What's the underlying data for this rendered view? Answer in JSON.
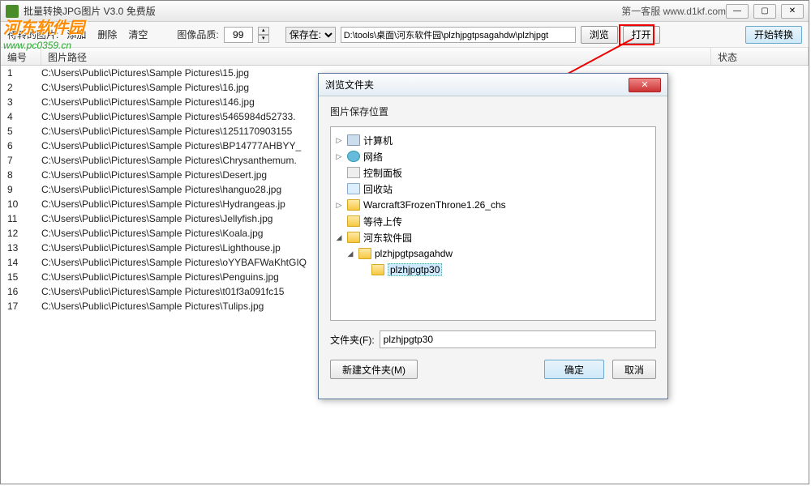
{
  "window": {
    "title": "批量转换JPG图片 V3.0 免费版",
    "subtitle": "第一客服 www.d1kf.com"
  },
  "watermark": {
    "line1": "河东软件园",
    "line2": "www.pc0359.cn"
  },
  "toolbar": {
    "label_images": "待转的图片:",
    "add": "添加",
    "del": "删除",
    "clear": "清空",
    "quality_label": "图像品质:",
    "quality_value": "99",
    "save_at_label": "保存在:",
    "save_at_selected": "▼",
    "path": "D:\\tools\\桌面\\河东软件园\\plzhjpgtpsagahdw\\plzhjpgt",
    "browse": "浏览",
    "open": "打开",
    "start": "开始转换"
  },
  "columns": {
    "num": "编号",
    "path": "图片路径",
    "status": "状态"
  },
  "rows": [
    {
      "n": "1",
      "p": "C:\\Users\\Public\\Pictures\\Sample Pictures\\15.jpg"
    },
    {
      "n": "2",
      "p": "C:\\Users\\Public\\Pictures\\Sample Pictures\\16.jpg"
    },
    {
      "n": "3",
      "p": "C:\\Users\\Public\\Pictures\\Sample Pictures\\146.jpg"
    },
    {
      "n": "4",
      "p": "C:\\Users\\Public\\Pictures\\Sample Pictures\\5465984d52733."
    },
    {
      "n": "5",
      "p": "C:\\Users\\Public\\Pictures\\Sample Pictures\\1251170903155"
    },
    {
      "n": "6",
      "p": "C:\\Users\\Public\\Pictures\\Sample Pictures\\BP14777AHBYY_"
    },
    {
      "n": "7",
      "p": "C:\\Users\\Public\\Pictures\\Sample Pictures\\Chrysanthemum."
    },
    {
      "n": "8",
      "p": "C:\\Users\\Public\\Pictures\\Sample Pictures\\Desert.jpg"
    },
    {
      "n": "9",
      "p": "C:\\Users\\Public\\Pictures\\Sample Pictures\\hanguo28.jpg"
    },
    {
      "n": "10",
      "p": "C:\\Users\\Public\\Pictures\\Sample Pictures\\Hydrangeas.jp"
    },
    {
      "n": "11",
      "p": "C:\\Users\\Public\\Pictures\\Sample Pictures\\Jellyfish.jpg"
    },
    {
      "n": "12",
      "p": "C:\\Users\\Public\\Pictures\\Sample Pictures\\Koala.jpg"
    },
    {
      "n": "13",
      "p": "C:\\Users\\Public\\Pictures\\Sample Pictures\\Lighthouse.jp"
    },
    {
      "n": "14",
      "p": "C:\\Users\\Public\\Pictures\\Sample Pictures\\oYYBAFWaKhtGIQ"
    },
    {
      "n": "15",
      "p": "C:\\Users\\Public\\Pictures\\Sample Pictures\\Penguins.jpg"
    },
    {
      "n": "16",
      "p": "C:\\Users\\Public\\Pictures\\Sample Pictures\\t01f3a091fc15"
    },
    {
      "n": "17",
      "p": "C:\\Users\\Public\\Pictures\\Sample Pictures\\Tulips.jpg"
    }
  ],
  "dialog": {
    "title": "浏览文件夹",
    "label": "图片保存位置",
    "tree": [
      {
        "indent": 0,
        "exp": "▷",
        "icon": "computer",
        "text": "计算机"
      },
      {
        "indent": 0,
        "exp": "▷",
        "icon": "network",
        "text": "网络"
      },
      {
        "indent": 0,
        "exp": "",
        "icon": "cpanel",
        "text": "控制面板"
      },
      {
        "indent": 0,
        "exp": "",
        "icon": "recycle",
        "text": "回收站"
      },
      {
        "indent": 0,
        "exp": "▷",
        "icon": "folder",
        "text": "Warcraft3FrozenThrone1.26_chs"
      },
      {
        "indent": 0,
        "exp": "",
        "icon": "folder",
        "text": "等待上传"
      },
      {
        "indent": 0,
        "exp": "◢",
        "icon": "folder-open",
        "text": "河东软件园"
      },
      {
        "indent": 1,
        "exp": "◢",
        "icon": "folder-open",
        "text": "plzhjpgtpsagahdw"
      },
      {
        "indent": 2,
        "exp": "",
        "icon": "folder",
        "text": "plzhjpgtp30",
        "sel": true
      }
    ],
    "folder_label": "文件夹(F):",
    "folder_value": "plzhjpgtp30",
    "new_folder": "新建文件夹(M)",
    "ok": "确定",
    "cancel": "取消"
  }
}
